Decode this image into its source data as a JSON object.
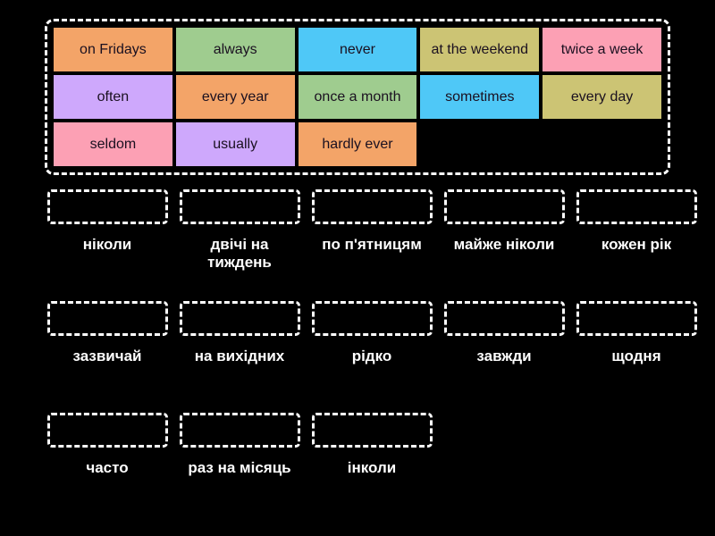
{
  "colors": {
    "background": "#000000",
    "border": "#ffffff",
    "label_text": "#ffffff",
    "tile_text": "#1a1020",
    "orange": "#F3A468",
    "green": "#9FCC8F",
    "blue": "#4FC8F7",
    "khaki": "#CCC474",
    "pink": "#FCA0B4",
    "purple": "#CEA8FC"
  },
  "tile_bank": {
    "rows": [
      [
        {
          "label": "on Fridays",
          "color": "#F3A468"
        },
        {
          "label": "always",
          "color": "#9FCC8F"
        },
        {
          "label": "never",
          "color": "#4FC8F7"
        },
        {
          "label": "at the weekend",
          "color": "#CCC474"
        },
        {
          "label": "twice a week",
          "color": "#FCA0B4"
        }
      ],
      [
        {
          "label": "often",
          "color": "#CEA8FC"
        },
        {
          "label": "every year",
          "color": "#F3A468"
        },
        {
          "label": "once a month",
          "color": "#9FCC8F"
        },
        {
          "label": "sometimes",
          "color": "#4FC8F7"
        },
        {
          "label": "every day",
          "color": "#CCC474"
        }
      ],
      [
        {
          "label": "seldom",
          "color": "#FCA0B4"
        },
        {
          "label": "usually",
          "color": "#CEA8FC"
        },
        {
          "label": "hardly ever",
          "color": "#F3A468"
        },
        {
          "label": "",
          "color": "transparent"
        },
        {
          "label": "",
          "color": "transparent"
        }
      ]
    ]
  },
  "drop_area": {
    "rows": [
      [
        {
          "label": "ніколи",
          "filled": false
        },
        {
          "label": "двічі на тиждень",
          "filled": false
        },
        {
          "label": "по п'ятницям",
          "filled": false
        },
        {
          "label": "майже ніколи",
          "filled": false
        },
        {
          "label": "кожен рік",
          "filled": false
        }
      ],
      [
        {
          "label": "зазвичай",
          "filled": false
        },
        {
          "label": "на вихідних",
          "filled": false
        },
        {
          "label": "рідко",
          "filled": false
        },
        {
          "label": "завжди",
          "filled": false
        },
        {
          "label": "щодня",
          "filled": false
        }
      ],
      [
        {
          "label": "часто",
          "filled": false
        },
        {
          "label": "раз на місяць",
          "filled": false
        },
        {
          "label": "інколи",
          "filled": false
        },
        {
          "label": "",
          "filled": false
        },
        {
          "label": "",
          "filled": false
        }
      ]
    ]
  }
}
